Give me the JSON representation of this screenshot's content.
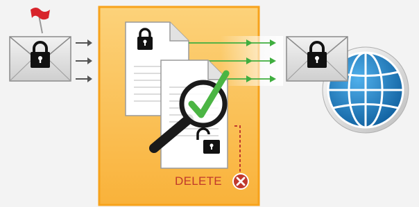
{
  "diagram": {
    "delete_label": "DELETE",
    "icons": {
      "flag": "flag-icon",
      "incoming_envelope": "envelope-lock-icon",
      "document": "document-lock-icon",
      "magnifier": "magnifier-check-icon",
      "open_lock": "unlock-icon",
      "delete": "delete-x-icon",
      "outgoing_envelope": "envelope-lock-icon",
      "globe": "globe-icon"
    },
    "colors": {
      "panel_fill": "#fbc04c",
      "panel_border": "#f7a21b",
      "flow_arrow": "#3fae3f",
      "input_arrow": "#555555",
      "delete_red": "#c0392b",
      "check_green": "#4bb543",
      "globe_blue": "#1f7fc4"
    }
  }
}
